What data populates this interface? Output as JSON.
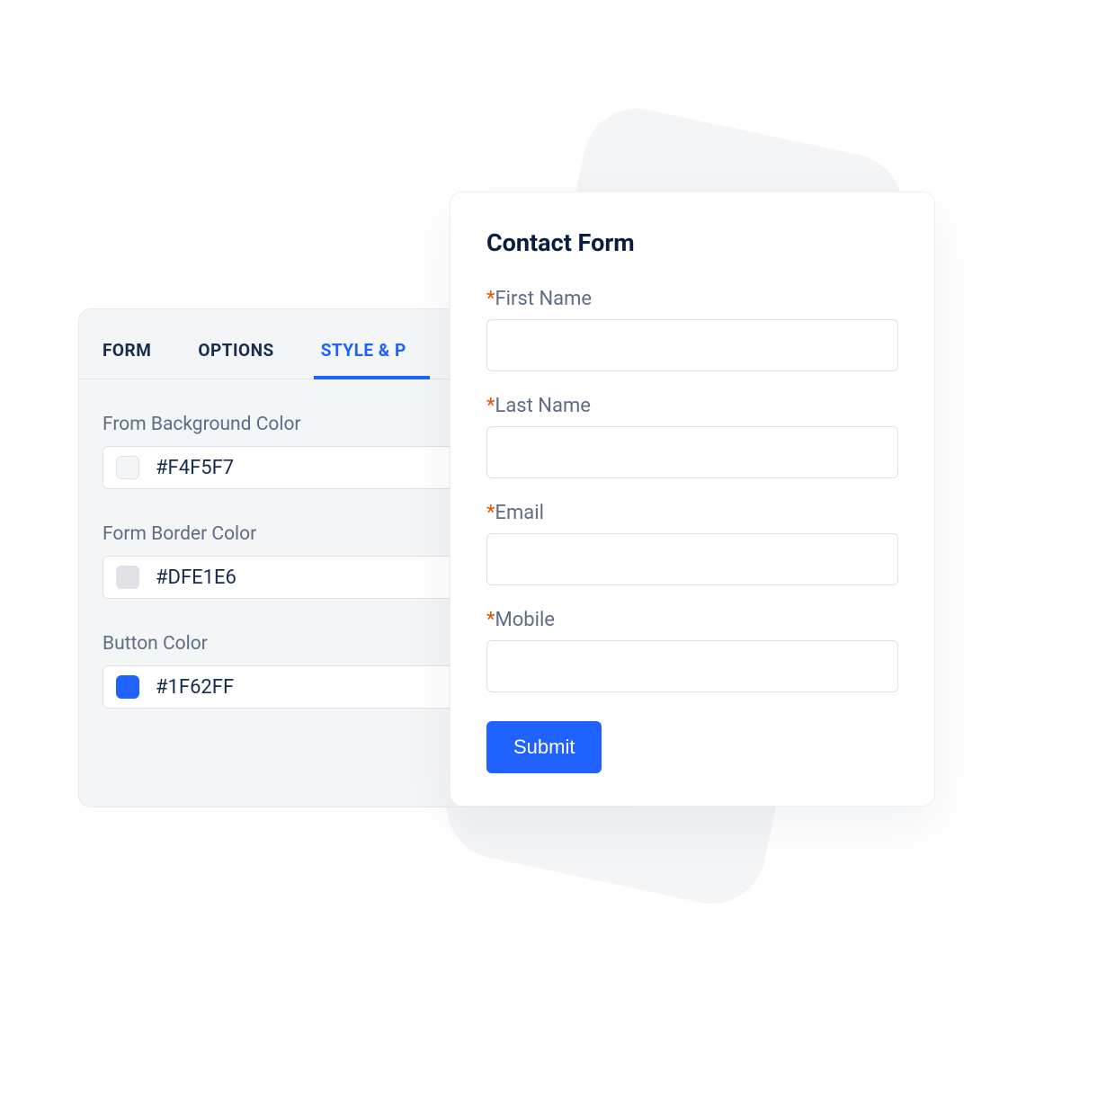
{
  "settings": {
    "tabs": [
      {
        "label": "FORM",
        "active": false
      },
      {
        "label": "OPTIONS",
        "active": false
      },
      {
        "label": "STYLE & P",
        "active": true
      }
    ],
    "fields": {
      "background": {
        "label": "From Background Color",
        "value": "#F4F5F7",
        "swatch_color": "#F4F5F7"
      },
      "border": {
        "label": "Form Border Color",
        "value": "#DFE1E6",
        "swatch_color": "#DFE1E6"
      },
      "button": {
        "label": "Button Color",
        "value": "#1F62FF",
        "swatch_color": "#1F62FF"
      }
    }
  },
  "contact": {
    "title": "Contact Form",
    "required_marker": "*",
    "fields": {
      "first_name": {
        "label": "First Name",
        "required": true
      },
      "last_name": {
        "label": "Last Name",
        "required": true
      },
      "email": {
        "label": "Email",
        "required": true
      },
      "mobile": {
        "label": "Mobile",
        "required": true
      }
    },
    "submit_label": "Submit"
  },
  "colors": {
    "accent": "#1F62FF",
    "text_dark": "#172B4D",
    "text_muted": "#5E6C84",
    "required": "#E65100"
  }
}
